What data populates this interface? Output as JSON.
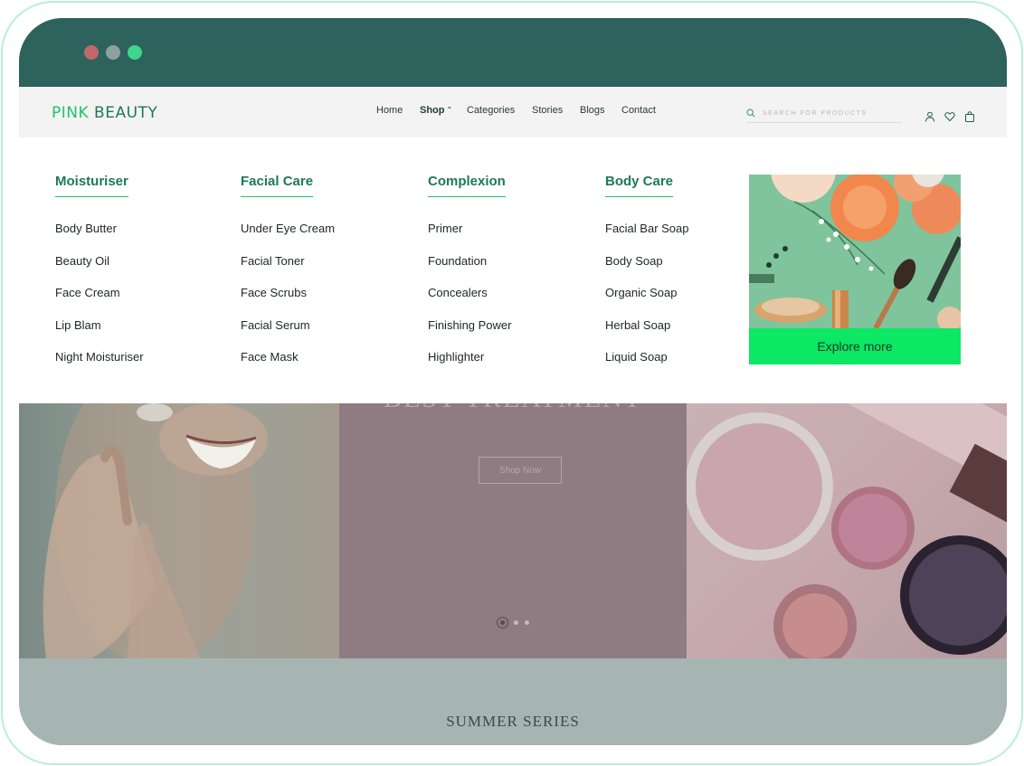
{
  "brand": {
    "name_part1": "PINK",
    "name_part2": "BEAUTY"
  },
  "nav": {
    "links": [
      "Home",
      "Shop",
      "Categories",
      "Stories",
      "Blogs",
      "Contact"
    ],
    "active": "Shop",
    "search_placeholder": "SEARCH FOR PRODUCTS"
  },
  "mega_menu": {
    "columns": [
      {
        "heading": "Moisturiser",
        "items": [
          "Body Butter",
          "Beauty Oil",
          "Face Cream",
          "Lip Blam",
          "Night Moisturiser"
        ]
      },
      {
        "heading": "Facial Care",
        "items": [
          "Under Eye Cream",
          "Facial Toner",
          "Face Scrubs",
          "Facial Serum",
          "Face Mask"
        ]
      },
      {
        "heading": "Complexion",
        "items": [
          "Primer",
          "Foundation",
          "Concealers",
          "Finishing Power",
          "Highlighter"
        ]
      },
      {
        "heading": "Body Care",
        "items": [
          "Facial Bar Soap",
          "Body Soap",
          "Organic Soap",
          "Herbal Soap",
          "Liquid Soap"
        ]
      }
    ],
    "promo_button": "Explore more"
  },
  "hero": {
    "title": "BEST TREATMENT",
    "button": "Shop Now",
    "slide_count": 3,
    "active_slide": 1
  },
  "section": {
    "title": "SUMMER SERIES"
  },
  "colors": {
    "titlebar": "#2d625d",
    "brand_green": "#1ec36b",
    "heading_green": "#1d7a54",
    "explore_button": "#0ce764"
  },
  "icons": [
    "search-icon",
    "user-icon",
    "heart-icon",
    "bag-icon",
    "chevron-up-icon"
  ]
}
